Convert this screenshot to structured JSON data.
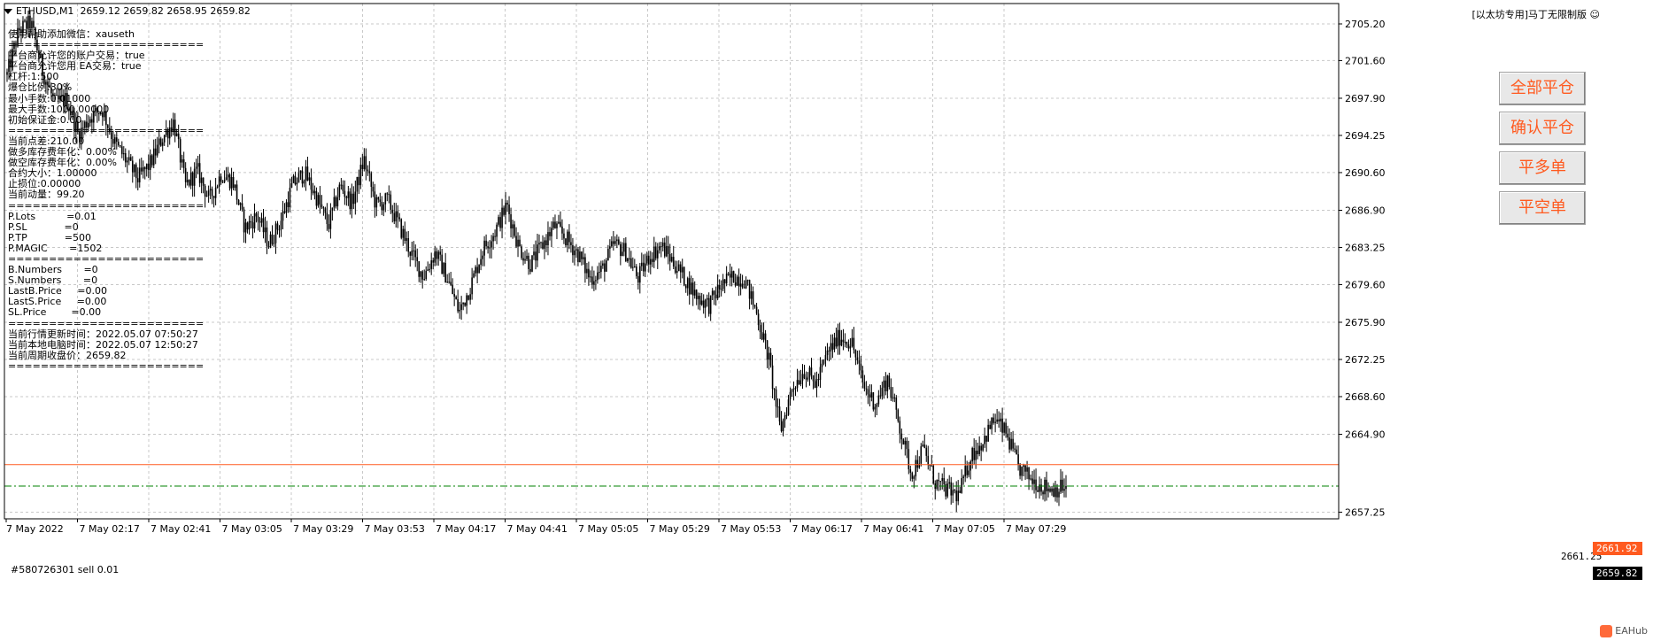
{
  "header": {
    "title": "ETHUSD,M1",
    "ohlc": "2659.12 2659.82 2658.95 2659.82"
  },
  "ea_name": "[以太坊专用]马丁无限制版",
  "info_lines": [
    "使用帮助添加微信：xauseth",
    "========================",
    "平台商允许您的账户交易：true",
    "平台商允许您用 EA交易：true",
    "杠杆:1:500",
    "爆仓比例:30%",
    "最小手数:0.01000",
    "最大手数:1000.00000",
    "初始保证金:0.00",
    "========================",
    "当前点差:210.00",
    "做多库存费年化：0.00%",
    "做空库存费年化：0.00%",
    "合约大小：1.00000",
    "止损位:0.00000",
    "当前动量：99.20",
    "========================",
    "P.Lots          =0.01",
    "P.SL            =0",
    "P.TP            =500",
    "P.MAGIC       =1502",
    "========================",
    "B.Numbers       =0",
    "S.Numbers       =0",
    "LastB.Price     =0.00",
    "LastS.Price     =0.00",
    "SL.Price        =0.00",
    "========================",
    "当前行情更新时间：2022.05.07 07:50:27",
    "当前本地电脑时间：2022.05.07 12:50:27",
    "当前周期收盘价：2659.82",
    "========================"
  ],
  "buttons": {
    "close_all": "全部平仓",
    "confirm_close": "确认平仓",
    "close_long": "平多单",
    "close_short": "平空单"
  },
  "order_label": "#580726301 sell 0.01",
  "price_tags": {
    "sell_line": "2661.92",
    "bid": "2659.82",
    "partial_tick": "2661.25"
  },
  "watermark": "EAHub",
  "colors": {
    "sell_line": "#ff5a1f",
    "bid_line": "#008000",
    "candles": "#000000",
    "grid": "#c8c8c8",
    "button_text": "#ff5a1f"
  },
  "chart_data": {
    "type": "candlestick",
    "ylim": [
      2656.6,
      2707.2
    ],
    "y_ticks": [
      2705.2,
      2701.6,
      2697.9,
      2694.25,
      2690.6,
      2686.9,
      2683.25,
      2679.6,
      2675.9,
      2672.25,
      2668.6,
      2664.9,
      2657.25
    ],
    "x_ticks": [
      "7 May 2022",
      "7 May 02:17",
      "7 May 02:41",
      "7 May 03:05",
      "7 May 03:29",
      "7 May 03:53",
      "7 May 04:17",
      "7 May 04:41",
      "7 May 05:05",
      "7 May 05:29",
      "7 May 05:53",
      "7 May 06:17",
      "7 May 06:41",
      "7 May 07:05",
      "7 May 07:29"
    ],
    "trend_close": [
      2700.2,
      2704.6,
      2705.3,
      2700.5,
      2697.4,
      2697.8,
      2694.3,
      2696.1,
      2696.8,
      2693.6,
      2691.8,
      2690.0,
      2691.4,
      2693.9,
      2695.6,
      2689.3,
      2690.8,
      2687.9,
      2690.5,
      2689.7,
      2685.1,
      2686.4,
      2683.6,
      2685.8,
      2689.4,
      2690.6,
      2688.2,
      2685.4,
      2689.3,
      2687.6,
      2691.9,
      2687.4,
      2687.9,
      2685.3,
      2682.6,
      2680.4,
      2682.8,
      2680.2,
      2676.9,
      2679.6,
      2683.1,
      2684.8,
      2687.4,
      2683.3,
      2681.6,
      2683.5,
      2685.4,
      2684.1,
      2682.6,
      2680.2,
      2681.0,
      2683.6,
      2682.8,
      2680.2,
      2682.4,
      2683.4,
      2681.8,
      2680.1,
      2678.4,
      2677.6,
      2679.5,
      2680.4,
      2680.1,
      2676.8,
      2672.4,
      2665.2,
      2669.6,
      2671.2,
      2669.8,
      2673.0,
      2674.5,
      2673.9,
      2669.6,
      2667.9,
      2670.4,
      2665.8,
      2661.0,
      2663.5,
      2660.2,
      2659.4,
      2658.9,
      2662.8,
      2664.2,
      2666.4,
      2664.9,
      2661.6,
      2660.6,
      2659.8,
      2659.5,
      2659.8
    ],
    "last_close": 2659.82,
    "sell_order_price": 2661.92
  }
}
